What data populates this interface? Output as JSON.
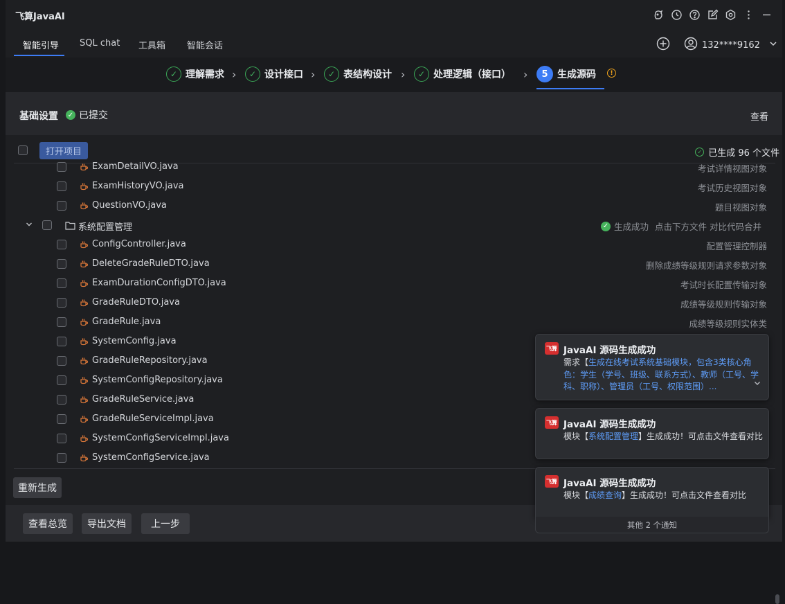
{
  "app": {
    "title": "飞算JavaAI"
  },
  "tabs": [
    {
      "label": "智能引导"
    },
    {
      "label": "SQL chat"
    },
    {
      "label": "工具箱"
    },
    {
      "label": "智能会话"
    }
  ],
  "user": {
    "name": "132****9162"
  },
  "steps": [
    {
      "label": "理解需求"
    },
    {
      "label": "设计接口"
    },
    {
      "label": "表结构设计"
    },
    {
      "label": "处理逻辑（接口）"
    },
    {
      "number": "5",
      "label": "生成源码"
    }
  ],
  "basic": {
    "label": "基础设置",
    "status": "已提交",
    "view": "查看"
  },
  "files_header": {
    "open_project": "打开项目",
    "generated": "已生成 96 个文件"
  },
  "files": [
    {
      "name": "ExamDetailVO.java",
      "desc": "考试详情视图对象"
    },
    {
      "name": "ExamHistoryVO.java",
      "desc": "考试历史视图对象"
    },
    {
      "name": "QuestionVO.java",
      "desc": "题目视图对象"
    }
  ],
  "folder": {
    "name": "系统配置管理",
    "status": "生成成功",
    "hint": "点击下方文件 对比代码合并"
  },
  "folder_files": [
    {
      "name": "ConfigController.java",
      "desc": "配置管理控制器"
    },
    {
      "name": "DeleteGradeRuleDTO.java",
      "desc": "删除成绩等级规则请求参数对象"
    },
    {
      "name": "ExamDurationConfigDTO.java",
      "desc": "考试时长配置传输对象"
    },
    {
      "name": "GradeRuleDTO.java",
      "desc": "成绩等级规则传输对象"
    },
    {
      "name": "GradeRule.java",
      "desc": "成绩等级规则实体类"
    },
    {
      "name": "SystemConfig.java",
      "desc": ""
    },
    {
      "name": "GradeRuleRepository.java",
      "desc": ""
    },
    {
      "name": "SystemConfigRepository.java",
      "desc": ""
    },
    {
      "name": "GradeRuleService.java",
      "desc": ""
    },
    {
      "name": "GradeRuleServiceImpl.java",
      "desc": ""
    },
    {
      "name": "SystemConfigServiceImpl.java",
      "desc": ""
    },
    {
      "name": "SystemConfigService.java",
      "desc": ""
    }
  ],
  "buttons": {
    "regenerate": "重新生成",
    "overview": "查看总览",
    "export": "导出文档",
    "previous": "上一步"
  },
  "notifications": [
    {
      "logo": "飞算",
      "title": "JavaAI 源码生成成功",
      "prefix": "需求【",
      "highlight": "生成在线考试系统基础模块，包含3类核心角色：学生（学号、班级、联系方式）、教师（工号、学科、职称）、管理员（工号、权限范围）...",
      "suffix": ""
    },
    {
      "logo": "飞算",
      "title": "JavaAI 源码生成成功",
      "prefix": "模块【",
      "highlight": "系统配置管理",
      "suffix": "】生成成功！可点击文件查看对比"
    },
    {
      "logo": "飞算",
      "title": "JavaAI 源码生成成功",
      "prefix": "模块【",
      "highlight": "成绩查询",
      "suffix": "】生成成功！可点击文件查看对比"
    }
  ],
  "more_notifications": "其他 2 个通知",
  "colors": {
    "accent": "#3d7cf5",
    "success": "#46b35c",
    "warning": "#f0a41c",
    "brand": "#d52f2f"
  },
  "icons": [
    "ai-assistant-icon",
    "history-icon",
    "help-icon",
    "edit-icon",
    "settings-icon",
    "more-icon",
    "minimize-icon",
    "plus-icon",
    "user-icon",
    "chevron-down-icon",
    "check-icon",
    "chevron-right-icon",
    "info-icon",
    "java-file-icon",
    "folder-icon"
  ]
}
